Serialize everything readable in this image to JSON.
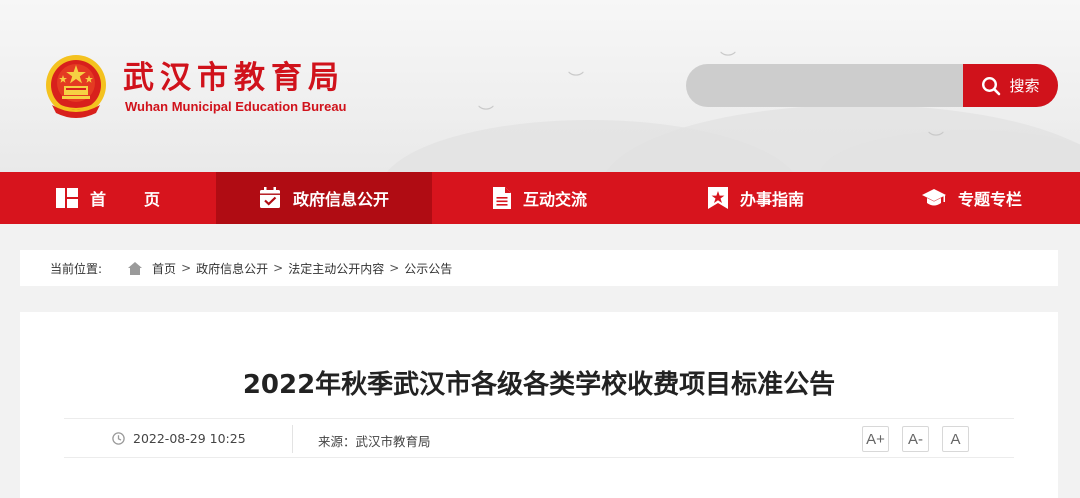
{
  "header": {
    "title_cn": "武汉市教育局",
    "title_en": "Wuhan Municipal Education Bureau"
  },
  "search": {
    "placeholder": "",
    "button_label": "搜索"
  },
  "nav": {
    "items": [
      {
        "label": "首页",
        "icon": "grid-icon"
      },
      {
        "label": "政府信息公开",
        "icon": "calendar-check-icon"
      },
      {
        "label": "互动交流",
        "icon": "document-icon"
      },
      {
        "label": "办事指南",
        "icon": "bookmark-star-icon"
      },
      {
        "label": "专题专栏",
        "icon": "graduation-cap-icon"
      }
    ],
    "active_index": 1
  },
  "breadcrumb": {
    "prefix": "当前位置:",
    "items": [
      "首页",
      "政府信息公开",
      "法定主动公开内容",
      "公示公告"
    ],
    "separator": ">"
  },
  "article": {
    "title": "2022年秋季武汉市各级各类学校收费项目标准公告",
    "date": "2022-08-29 10:25",
    "source": "来源：武汉市教育局",
    "font_controls": [
      "A+",
      "A-",
      "A"
    ]
  },
  "colors": {
    "brand_red": "#d7141d",
    "active_nav": "#b00c13"
  }
}
